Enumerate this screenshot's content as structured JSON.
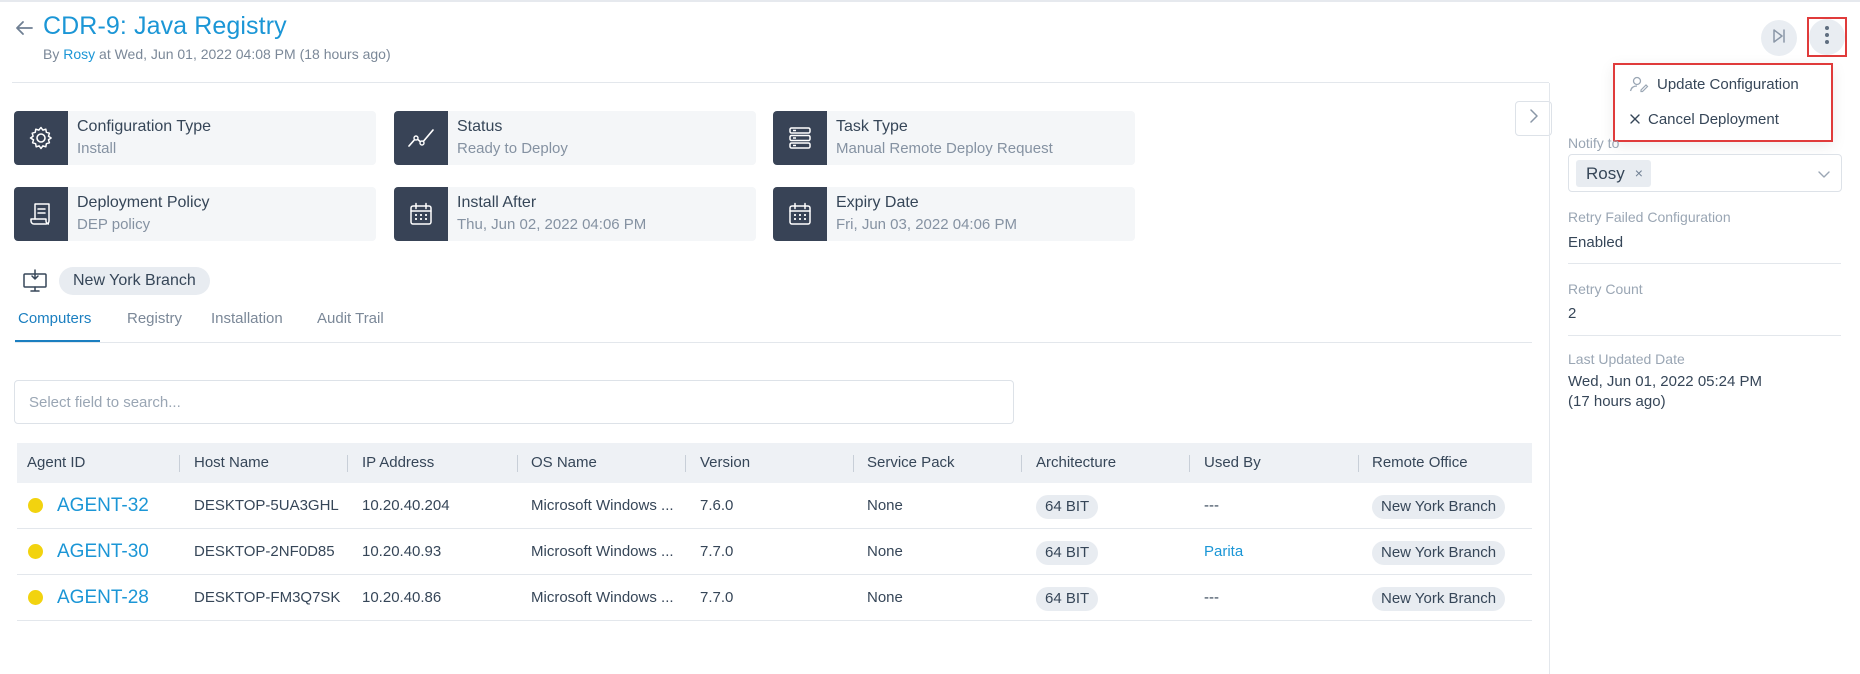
{
  "header": {
    "title": "CDR-9: Java Registry",
    "meta_by": "By ",
    "meta_user": "Rosy",
    "meta_rest": " at Wed, Jun 01, 2022 04:08 PM (18 hours ago)"
  },
  "menu": {
    "items": [
      {
        "label": "Update Configuration",
        "icon": "user-edit-icon"
      },
      {
        "label": "Cancel Deployment",
        "icon": "close-icon"
      }
    ]
  },
  "cards": [
    {
      "label": "Configuration Type",
      "value": "Install",
      "icon": "gear-icon"
    },
    {
      "label": "Status",
      "value": "Ready to Deploy",
      "icon": "trend-line-icon"
    },
    {
      "label": "Task Type",
      "value": "Manual Remote Deploy Request",
      "icon": "task-list-icon"
    },
    {
      "label": "Deployment Policy",
      "value": "DEP policy",
      "icon": "policy-scroll-icon"
    },
    {
      "label": "Install After",
      "value": "Thu, Jun 02, 2022 04:06 PM",
      "icon": "calendar-icon"
    },
    {
      "label": "Expiry Date",
      "value": "Fri, Jun 03, 2022 04:06 PM",
      "icon": "calendar-icon"
    }
  ],
  "location": {
    "label": "New York Branch"
  },
  "tabs": [
    {
      "label": "Computers",
      "active": true
    },
    {
      "label": "Registry",
      "active": false
    },
    {
      "label": "Installation",
      "active": false
    },
    {
      "label": "Audit Trail",
      "active": false
    }
  ],
  "search": {
    "placeholder": "Select field to search..."
  },
  "table": {
    "columns": [
      "Agent ID",
      "Host Name",
      "IP Address",
      "OS Name",
      "Version",
      "Service Pack",
      "Architecture",
      "Used By",
      "Remote Office"
    ],
    "rows": [
      {
        "agent": "AGENT-32",
        "host": "DESKTOP-5UA3GHL",
        "ip": "10.20.40.204",
        "os": "Microsoft Windows ...",
        "version": "7.6.0",
        "sp": "None",
        "arch": "64 BIT",
        "used_by": "---",
        "office": "New York Branch"
      },
      {
        "agent": "AGENT-30",
        "host": "DESKTOP-2NF0D85",
        "ip": "10.20.40.93",
        "os": "Microsoft Windows ...",
        "version": "7.7.0",
        "sp": "None",
        "arch": "64 BIT",
        "used_by": "Parita",
        "office": "New York Branch"
      },
      {
        "agent": "AGENT-28",
        "host": "DESKTOP-FM3Q7SK",
        "ip": "10.20.40.86",
        "os": "Microsoft Windows ...",
        "version": "7.7.0",
        "sp": "None",
        "arch": "64 BIT",
        "used_by": "---",
        "office": "New York Branch"
      }
    ]
  },
  "panel": {
    "notify_label": "Notify to",
    "notify_user": "Rosy",
    "notify_remove": "×",
    "retry_failed_label": "Retry Failed Configuration",
    "retry_failed_value": "Enabled",
    "retry_count_label": "Retry Count",
    "retry_count_value": "2",
    "last_updated_label": "Last Updated Date",
    "last_updated_value": "Wed, Jun 01, 2022 05:24 PM",
    "last_updated_ago": "(17 hours ago)"
  },
  "colors": {
    "accent": "#1b96d6",
    "card_icon_bg": "#384356",
    "status_dot": "#f2d30f",
    "highlight_border": "#e03b3b"
  }
}
